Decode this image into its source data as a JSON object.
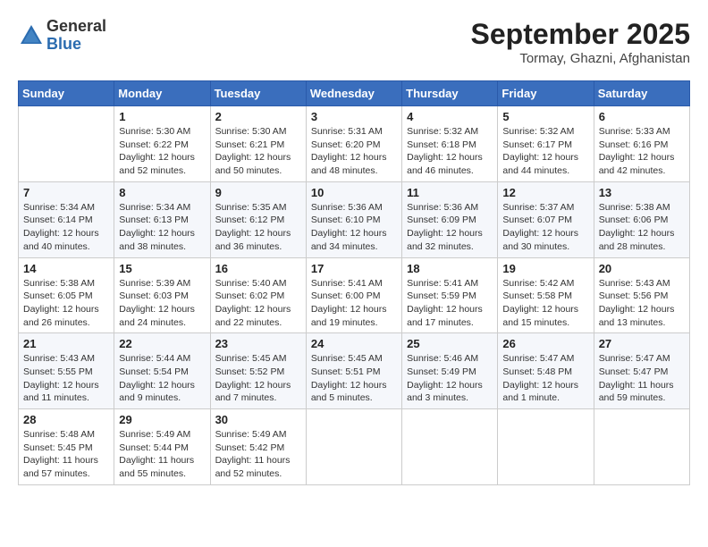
{
  "header": {
    "logo_general": "General",
    "logo_blue": "Blue",
    "month_title": "September 2025",
    "location": "Tormay, Ghazni, Afghanistan"
  },
  "weekdays": [
    "Sunday",
    "Monday",
    "Tuesday",
    "Wednesday",
    "Thursday",
    "Friday",
    "Saturday"
  ],
  "weeks": [
    [
      {
        "day": "",
        "info": ""
      },
      {
        "day": "1",
        "info": "Sunrise: 5:30 AM\nSunset: 6:22 PM\nDaylight: 12 hours\nand 52 minutes."
      },
      {
        "day": "2",
        "info": "Sunrise: 5:30 AM\nSunset: 6:21 PM\nDaylight: 12 hours\nand 50 minutes."
      },
      {
        "day": "3",
        "info": "Sunrise: 5:31 AM\nSunset: 6:20 PM\nDaylight: 12 hours\nand 48 minutes."
      },
      {
        "day": "4",
        "info": "Sunrise: 5:32 AM\nSunset: 6:18 PM\nDaylight: 12 hours\nand 46 minutes."
      },
      {
        "day": "5",
        "info": "Sunrise: 5:32 AM\nSunset: 6:17 PM\nDaylight: 12 hours\nand 44 minutes."
      },
      {
        "day": "6",
        "info": "Sunrise: 5:33 AM\nSunset: 6:16 PM\nDaylight: 12 hours\nand 42 minutes."
      }
    ],
    [
      {
        "day": "7",
        "info": "Sunrise: 5:34 AM\nSunset: 6:14 PM\nDaylight: 12 hours\nand 40 minutes."
      },
      {
        "day": "8",
        "info": "Sunrise: 5:34 AM\nSunset: 6:13 PM\nDaylight: 12 hours\nand 38 minutes."
      },
      {
        "day": "9",
        "info": "Sunrise: 5:35 AM\nSunset: 6:12 PM\nDaylight: 12 hours\nand 36 minutes."
      },
      {
        "day": "10",
        "info": "Sunrise: 5:36 AM\nSunset: 6:10 PM\nDaylight: 12 hours\nand 34 minutes."
      },
      {
        "day": "11",
        "info": "Sunrise: 5:36 AM\nSunset: 6:09 PM\nDaylight: 12 hours\nand 32 minutes."
      },
      {
        "day": "12",
        "info": "Sunrise: 5:37 AM\nSunset: 6:07 PM\nDaylight: 12 hours\nand 30 minutes."
      },
      {
        "day": "13",
        "info": "Sunrise: 5:38 AM\nSunset: 6:06 PM\nDaylight: 12 hours\nand 28 minutes."
      }
    ],
    [
      {
        "day": "14",
        "info": "Sunrise: 5:38 AM\nSunset: 6:05 PM\nDaylight: 12 hours\nand 26 minutes."
      },
      {
        "day": "15",
        "info": "Sunrise: 5:39 AM\nSunset: 6:03 PM\nDaylight: 12 hours\nand 24 minutes."
      },
      {
        "day": "16",
        "info": "Sunrise: 5:40 AM\nSunset: 6:02 PM\nDaylight: 12 hours\nand 22 minutes."
      },
      {
        "day": "17",
        "info": "Sunrise: 5:41 AM\nSunset: 6:00 PM\nDaylight: 12 hours\nand 19 minutes."
      },
      {
        "day": "18",
        "info": "Sunrise: 5:41 AM\nSunset: 5:59 PM\nDaylight: 12 hours\nand 17 minutes."
      },
      {
        "day": "19",
        "info": "Sunrise: 5:42 AM\nSunset: 5:58 PM\nDaylight: 12 hours\nand 15 minutes."
      },
      {
        "day": "20",
        "info": "Sunrise: 5:43 AM\nSunset: 5:56 PM\nDaylight: 12 hours\nand 13 minutes."
      }
    ],
    [
      {
        "day": "21",
        "info": "Sunrise: 5:43 AM\nSunset: 5:55 PM\nDaylight: 12 hours\nand 11 minutes."
      },
      {
        "day": "22",
        "info": "Sunrise: 5:44 AM\nSunset: 5:54 PM\nDaylight: 12 hours\nand 9 minutes."
      },
      {
        "day": "23",
        "info": "Sunrise: 5:45 AM\nSunset: 5:52 PM\nDaylight: 12 hours\nand 7 minutes."
      },
      {
        "day": "24",
        "info": "Sunrise: 5:45 AM\nSunset: 5:51 PM\nDaylight: 12 hours\nand 5 minutes."
      },
      {
        "day": "25",
        "info": "Sunrise: 5:46 AM\nSunset: 5:49 PM\nDaylight: 12 hours\nand 3 minutes."
      },
      {
        "day": "26",
        "info": "Sunrise: 5:47 AM\nSunset: 5:48 PM\nDaylight: 12 hours\nand 1 minute."
      },
      {
        "day": "27",
        "info": "Sunrise: 5:47 AM\nSunset: 5:47 PM\nDaylight: 11 hours\nand 59 minutes."
      }
    ],
    [
      {
        "day": "28",
        "info": "Sunrise: 5:48 AM\nSunset: 5:45 PM\nDaylight: 11 hours\nand 57 minutes."
      },
      {
        "day": "29",
        "info": "Sunrise: 5:49 AM\nSunset: 5:44 PM\nDaylight: 11 hours\nand 55 minutes."
      },
      {
        "day": "30",
        "info": "Sunrise: 5:49 AM\nSunset: 5:42 PM\nDaylight: 11 hours\nand 52 minutes."
      },
      {
        "day": "",
        "info": ""
      },
      {
        "day": "",
        "info": ""
      },
      {
        "day": "",
        "info": ""
      },
      {
        "day": "",
        "info": ""
      }
    ]
  ]
}
